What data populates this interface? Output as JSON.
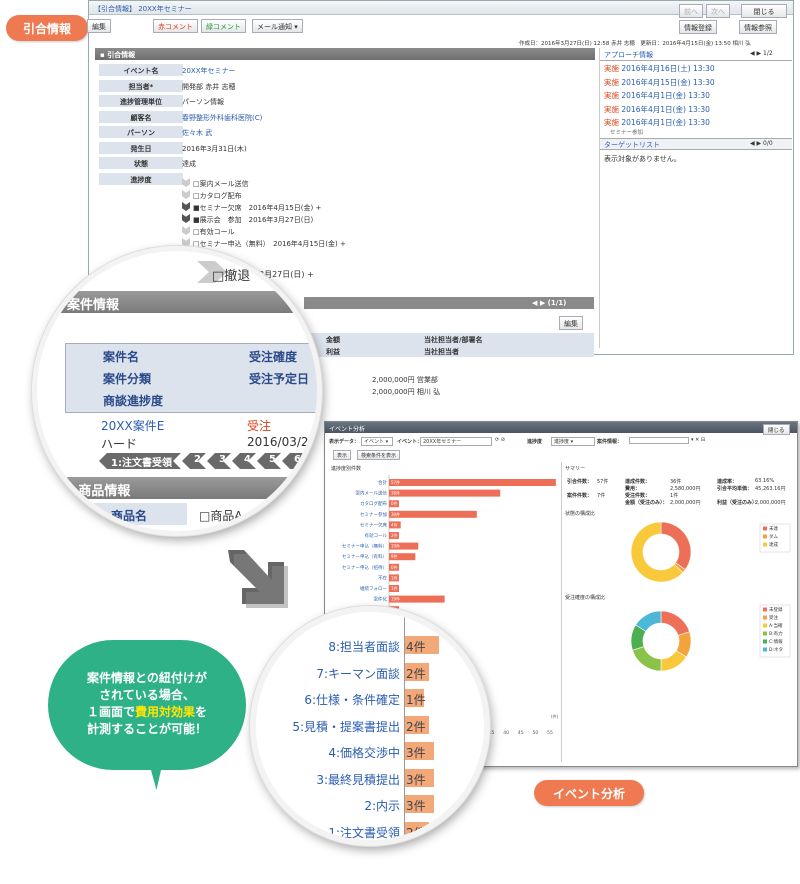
{
  "tags": {
    "hikiai": "引合情報",
    "event": "イベント分析"
  },
  "win1": {
    "title": "【引合情報】 20XX年セミナー",
    "toolbar": [
      "編集",
      "赤コメント",
      "緑コメント",
      "メール通知"
    ],
    "nav": [
      "前へ",
      "次へ",
      "閉じる"
    ],
    "actions": [
      "情報登録",
      "情報参照"
    ],
    "meta": "作成日：2016年3月27日(日) 12:58 赤井 志穂　更新日：2016年4月15日(金) 13:50 相川 弘",
    "section": "引合情報",
    "fields": [
      {
        "label": "イベント名",
        "value": "20XX年セミナー"
      },
      {
        "label": "担当者*",
        "value": "開発部 赤井 志穂"
      },
      {
        "label": "進捗管理単位",
        "value": "パーソン情報"
      },
      {
        "label": "顧客名",
        "value": "春野整形外科歯科医院(C)"
      },
      {
        "label": "パーソン",
        "value": "佐々木 武"
      },
      {
        "label": "発生日",
        "value": "2016年3月31日(木)"
      },
      {
        "label": "状態",
        "value": "達成"
      },
      {
        "label": "進捗度",
        "value": ""
      }
    ],
    "progress": [
      "□案内メール送信",
      "□カタログ配布",
      "■セミナー欠席　2016年4月15日(金) +",
      "■展示会　参加　2016年3月27日(日)",
      "□有効コール",
      "□セミナー申込（無料）　2016年4月15日(金) +"
    ],
    "progress_tail": "3月27日(日) +",
    "approach": {
      "title": "アプローチ情報",
      "pager": "1/2",
      "items": [
        {
          "status": "実施",
          "date": "2016年4月16日(土) 13:30"
        },
        {
          "status": "実施",
          "date": "2016年4月15日(金) 13:30"
        },
        {
          "status": "実施",
          "date": "2016年4月1日(金) 13:30"
        },
        {
          "status": "実施",
          "date": "2016年4月1日(金) 13:30"
        },
        {
          "status": "実施",
          "date": "2016年4月1日(金) 13:30",
          "note": "セミナー参加"
        }
      ]
    },
    "target": {
      "title": "ターゲットリスト",
      "pager": "0/0",
      "empty": "表示対象がありません。"
    },
    "case_partial": {
      "pager": "(1/1)",
      "edit": "編集",
      "heads": [
        "金額",
        "当社担当者/部署名",
        "利益",
        "当社担当者"
      ],
      "row": [
        "2,000,000円 営業部",
        "2,000,000円 相川 弘"
      ]
    }
  },
  "circle1": {
    "section": "案件情報",
    "heads": [
      "案件名",
      "受注確度",
      "案件分類",
      "受注予定日",
      "商談進捗度"
    ],
    "row": {
      "name": "20XX案件E",
      "status": "受注",
      "type": "ハード",
      "date": "2016/03/2"
    },
    "chevrons": [
      "1:注文書受領",
      "2",
      "3",
      "4",
      "5",
      "6"
    ],
    "product_section": "商品情報",
    "product_label": "商品名",
    "product_value": "□商品A",
    "partial": "撤退",
    "partial_prefix": "□"
  },
  "win2": {
    "title": "イベント分析",
    "close": "閉じる",
    "filters": {
      "data_label": "表示データ：",
      "data_value": "イベント",
      "event_label": "イベント：",
      "event_value": "20XX年セミナー",
      "progress_label": "進捗度",
      "progress_value": "進捗度",
      "case_label": "案件情報："
    },
    "buttons": [
      "表示",
      "検索条件を表示"
    ],
    "left_title": "進捗度別件数",
    "summary_title": "サマリー",
    "summary": [
      [
        "引合件数：",
        "57件",
        "達成件数：",
        "36件",
        "達成率：",
        "63.16%"
      ],
      [
        "",
        "",
        "費用：",
        "2,580,000円",
        "引合平均単価：",
        "45,263.16円"
      ],
      [
        "案件件数：",
        "7件",
        "受注件数：",
        "1件",
        "",
        ""
      ],
      [
        "",
        "",
        "金額（受注のみ）：",
        "2,000,000円",
        "利益（受注のみ）：",
        "2,000,000円"
      ]
    ],
    "pie1_title": "状態の構成比",
    "pie2_title": "受注確度の構成比",
    "pie1_legend": [
      "未達",
      "ダム",
      "達成"
    ],
    "pie2_legend": [
      "未登録",
      "受注",
      "A:当確",
      "B:有力",
      "C:情報",
      "D:ネタ"
    ],
    "axis_ticks": [
      "0",
      "5",
      "10",
      "15",
      "20",
      "25",
      "30",
      "35",
      "40",
      "45",
      "50",
      "55"
    ],
    "unit": "(件)",
    "bars": [
      {
        "label": "合計",
        "count": "57件",
        "value": 57
      },
      {
        "label": "案内メール送信",
        "count": "38件",
        "value": 38
      },
      {
        "label": "カタログ配布",
        "count": "0件",
        "value": 0
      },
      {
        "label": "セミナー参加",
        "count": "30件",
        "value": 30
      },
      {
        "label": "セミナー欠席",
        "count": "4件",
        "value": 4
      },
      {
        "label": "有効コール",
        "count": "2件",
        "value": 2
      },
      {
        "label": "セミナー申込（無料）",
        "count": "10件",
        "value": 10
      },
      {
        "label": "セミナー申込（有料）",
        "count": "9件",
        "value": 9
      },
      {
        "label": "セミナー申込（招待）",
        "count": "0件",
        "value": 0
      },
      {
        "label": "不在",
        "count": "1件",
        "value": 1
      },
      {
        "label": "継続フォロー",
        "count": "1件",
        "value": 1
      },
      {
        "label": "案件化",
        "count": "19件",
        "value": 19
      },
      {
        "label": "ダム",
        "count": "1件",
        "value": 1
      }
    ]
  },
  "circle2": {
    "rows": [
      {
        "label": "8:担当者面談",
        "count": "4件"
      },
      {
        "label": "7:キーマン面談",
        "count": "2件"
      },
      {
        "label": "6:仕様・条件確定",
        "count": "1件"
      },
      {
        "label": "5:見積・提案書提出",
        "count": "2件"
      },
      {
        "label": "4:価格交渉中",
        "count": "3件"
      },
      {
        "label": "3:最終見積提出",
        "count": "3件"
      },
      {
        "label": "2:内示",
        "count": "3件"
      },
      {
        "label": "1:注文書受領",
        "count": "2件"
      }
    ]
  },
  "bubble": {
    "line1": "案件情報との紐付けが",
    "line2": "されている場合、",
    "line3a": "１画面で",
    "line3b": "費用対効果",
    "line3c": "を",
    "line4": "計測することが可能！"
  },
  "chart_data": [
    {
      "type": "bar",
      "title": "進捗度別件数",
      "categories": [
        "合計",
        "案内メール送信",
        "カタログ配布",
        "セミナー参加",
        "セミナー欠席",
        "有効コール",
        "セミナー申込（無料）",
        "セミナー申込（有料）",
        "セミナー申込（招待）",
        "不在",
        "継続フォロー",
        "案件化",
        "ダム"
      ],
      "values": [
        57,
        38,
        0,
        30,
        4,
        2,
        10,
        9,
        0,
        1,
        1,
        19,
        1
      ],
      "xlim": [
        0,
        55
      ]
    },
    {
      "type": "pie",
      "title": "状態の構成比",
      "categories": [
        "未達",
        "ダム",
        "達成"
      ],
      "values": [
        35,
        2,
        63
      ],
      "colors": [
        "#ee6f57",
        "#f2a33c",
        "#f9c93b"
      ]
    },
    {
      "type": "pie",
      "title": "受注確度の構成比",
      "categories": [
        "未登録",
        "受注",
        "A:当確",
        "B:有力",
        "C:情報",
        "D:ネタ"
      ],
      "values": [
        20,
        14,
        16,
        20,
        14,
        16
      ],
      "colors": [
        "#ee6f57",
        "#f2a33c",
        "#f9c93b",
        "#8bc34a",
        "#4caf50",
        "#4bb8d8"
      ]
    }
  ]
}
